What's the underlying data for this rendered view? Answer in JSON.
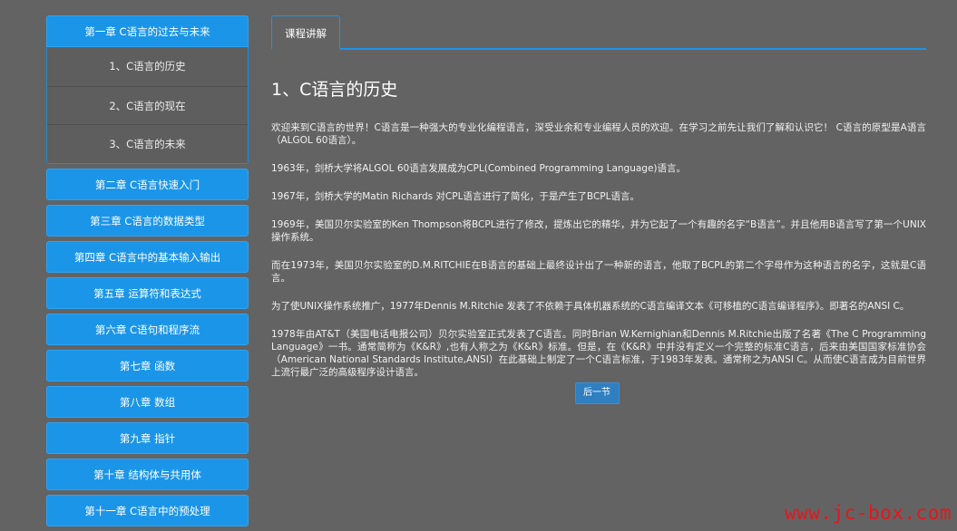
{
  "sidebar": {
    "chapter1": {
      "label": "第一章 C语言的过去与未来",
      "sections": [
        {
          "label": "1、C语言的历史"
        },
        {
          "label": "2、C语言的现在"
        },
        {
          "label": "3、C语言的未来"
        }
      ]
    },
    "chapters": [
      {
        "label": "第二章 C语言快速入门"
      },
      {
        "label": "第三章 C语言的数据类型"
      },
      {
        "label": "第四章 C语言中的基本输入输出"
      },
      {
        "label": "第五章 运算符和表达式"
      },
      {
        "label": "第六章 C语句和程序流"
      },
      {
        "label": "第七章 函数"
      },
      {
        "label": "第八章 数组"
      },
      {
        "label": "第九章 指针"
      },
      {
        "label": "第十章 结构体与共用体"
      },
      {
        "label": "第十一章 C语言中的预处理"
      }
    ]
  },
  "main": {
    "tab_label": "课程讲解",
    "title": "1、C语言的历史",
    "paragraphs": [
      "欢迎来到C语言的世界！C语言是一种强大的专业化编程语言，深受业余和专业编程人员的欢迎。在学习之前先让我们了解和认识它！ C语言的原型是A语言（ALGOL 60语言）。",
      "1963年，剑桥大学将ALGOL 60语言发展成为CPL(Combined Programming Language)语言。",
      "1967年，剑桥大学的Matin Richards 对CPL语言进行了简化，于是产生了BCPL语言。",
      "1969年，美国贝尔实验室的Ken Thompson将BCPL进行了修改，提炼出它的精华，并为它起了一个有趣的名字“B语言”。并且他用B语言写了第一个UNIX操作系统。",
      "而在1973年，美国贝尔实验室的D.M.RITCHIE在B语言的基础上最终设计出了一种新的语言，他取了BCPL的第二个字母作为这种语言的名字，这就是C语言。",
      "为了使UNIX操作系统推广，1977年Dennis M.Ritchie 发表了不依赖于具体机器系统的C语言编译文本《可移植的C语言编译程序》。即著名的ANSI C。",
      "1978年由AT&T（美国电话电报公司）贝尔实验室正式发表了C语言。同时Brian W.Kernighian和Dennis M.Ritchie出版了名著《The C Programming Language》一书。通常简称为《K&R》,也有人称之为《K&R》标准。但是，在《K&R》中并没有定义一个完整的标准C语言，后来由美国国家标准协会（American National Standards Institute,ANSI）在此基础上制定了一个C语言标准，于1983年发表。通常称之为ANSI C。从而使C语言成为目前世界上流行最广泛的高级程序设计语言。"
    ],
    "next_button": "后一节"
  },
  "watermark": "www.jc-box.com",
  "colors": {
    "background": "#636363",
    "accent": "#1b95e8",
    "button": "#2f7fc1",
    "watermark": "#e8151b"
  }
}
